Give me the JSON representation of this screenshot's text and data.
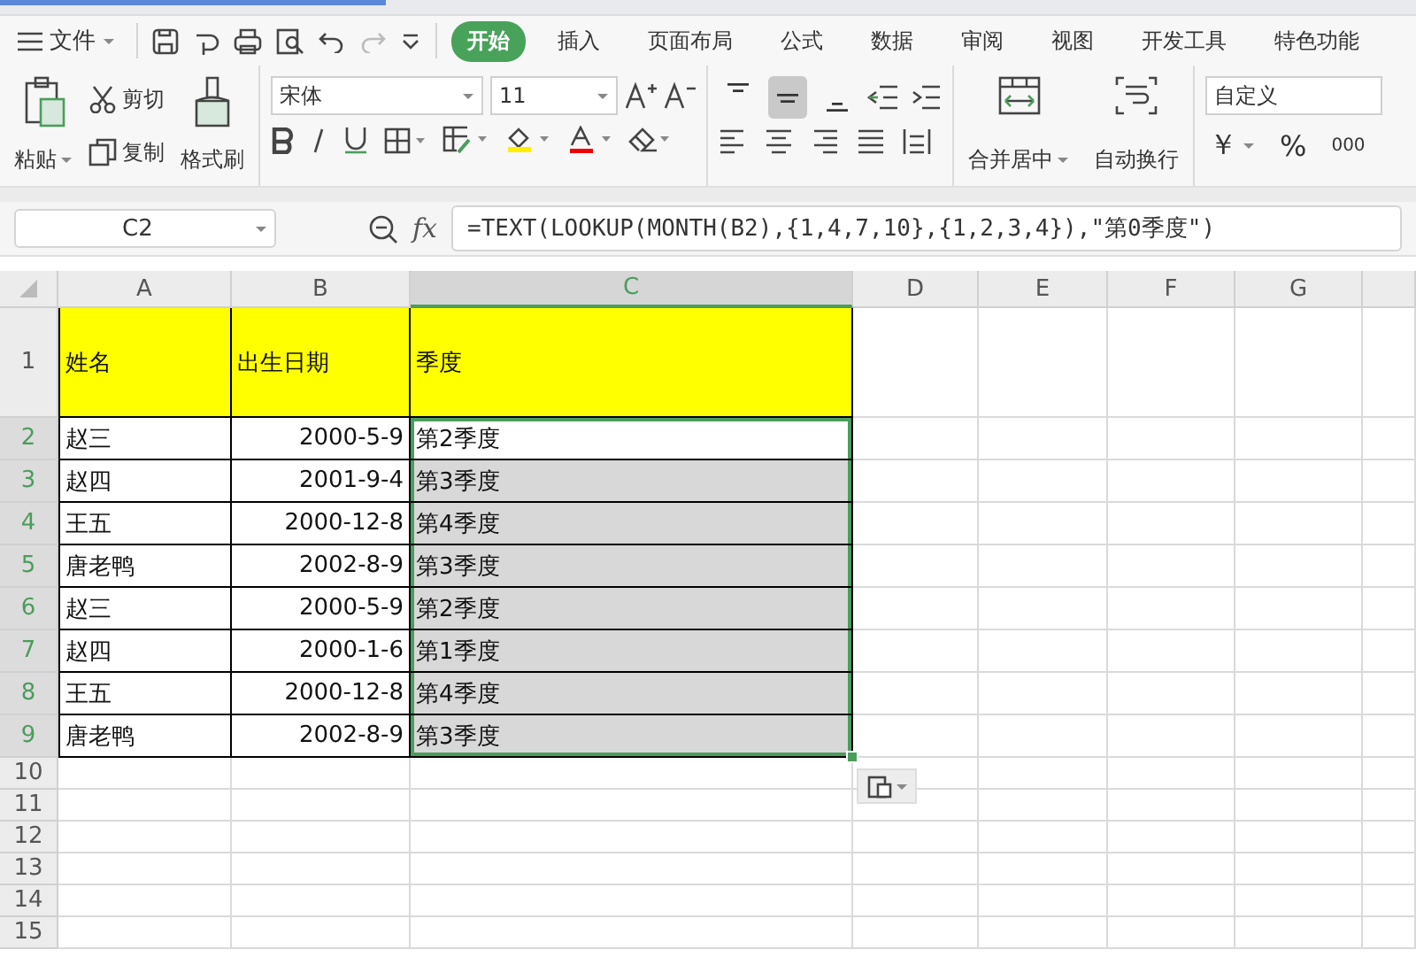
{
  "menu": {
    "file": "文件",
    "tabs": [
      {
        "label": "开始",
        "selected": true
      },
      {
        "label": "插入",
        "selected": false
      },
      {
        "label": "页面布局",
        "selected": false
      },
      {
        "label": "公式",
        "selected": false
      },
      {
        "label": "数据",
        "selected": false
      },
      {
        "label": "审阅",
        "selected": false
      },
      {
        "label": "视图",
        "selected": false
      },
      {
        "label": "开发工具",
        "selected": false
      },
      {
        "label": "特色功能",
        "selected": false
      }
    ]
  },
  "ribbon": {
    "paste": "粘贴",
    "cut": "剪切",
    "copy": "复制",
    "format_painter": "格式刷",
    "font_name": "宋体",
    "font_size": "11",
    "vertical_align": [
      {
        "selected": false
      },
      {
        "selected": true
      },
      {
        "selected": false
      }
    ],
    "merge_center": "合并居中",
    "wrap_text": "自动换行",
    "number_format": "自定义",
    "currency": "￥",
    "percent": "%",
    "thousands": "000"
  },
  "formula_bar": {
    "cell_ref": "C2",
    "function_label": "fx",
    "formula": "=TEXT(LOOKUP(MONTH(B2),{1,4,7,10},{1,2,3,4}),\"第0季度\")"
  },
  "sheet": {
    "columns": [
      {
        "label": "A",
        "selected": false
      },
      {
        "label": "B",
        "selected": false
      },
      {
        "label": "C",
        "selected": true
      },
      {
        "label": "D",
        "selected": false
      },
      {
        "label": "E",
        "selected": false
      },
      {
        "label": "F",
        "selected": false
      },
      {
        "label": "G",
        "selected": false
      }
    ],
    "rows": [
      {
        "number": "1",
        "kind": "header",
        "selected": false,
        "cells": [
          "姓名",
          "出生日期",
          "季度"
        ]
      },
      {
        "number": "2",
        "kind": "data",
        "selected": true,
        "active": true,
        "cells": [
          "赵三",
          "2000-5-9",
          "第2季度"
        ]
      },
      {
        "number": "3",
        "kind": "data",
        "selected": true,
        "active": false,
        "cells": [
          "赵四",
          "2001-9-4",
          "第3季度"
        ]
      },
      {
        "number": "4",
        "kind": "data",
        "selected": true,
        "active": false,
        "cells": [
          "王五",
          "2000-12-8",
          "第4季度"
        ]
      },
      {
        "number": "5",
        "kind": "data",
        "selected": true,
        "active": false,
        "cells": [
          "唐老鸭",
          "2002-8-9",
          "第3季度"
        ]
      },
      {
        "number": "6",
        "kind": "data",
        "selected": true,
        "active": false,
        "cells": [
          "赵三",
          "2000-5-9",
          "第2季度"
        ]
      },
      {
        "number": "7",
        "kind": "data",
        "selected": true,
        "active": false,
        "cells": [
          "赵四",
          "2000-1-6",
          "第1季度"
        ]
      },
      {
        "number": "8",
        "kind": "data",
        "selected": true,
        "active": false,
        "cells": [
          "王五",
          "2000-12-8",
          "第4季度"
        ]
      },
      {
        "number": "9",
        "kind": "data",
        "selected": true,
        "active": false,
        "cells": [
          "唐老鸭",
          "2002-8-9",
          "第3季度"
        ]
      },
      {
        "number": "10",
        "kind": "empty",
        "selected": false
      },
      {
        "number": "11",
        "kind": "empty",
        "selected": false
      },
      {
        "number": "12",
        "kind": "empty",
        "selected": false
      },
      {
        "number": "13",
        "kind": "empty",
        "selected": false
      },
      {
        "number": "14",
        "kind": "empty",
        "selected": false
      },
      {
        "number": "15",
        "kind": "empty",
        "selected": false
      }
    ]
  }
}
